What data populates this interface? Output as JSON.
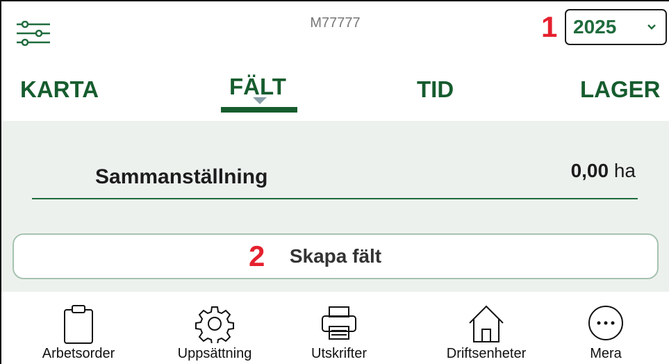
{
  "header": {
    "filter_icon": "filter-sliders-icon",
    "user_id": "M77777",
    "year_select": {
      "value": "2025"
    }
  },
  "annotations": {
    "marker_1": "1",
    "marker_2": "2"
  },
  "tabs": [
    {
      "label": "KARTA",
      "active": false
    },
    {
      "label": "FÄLT",
      "active": true
    },
    {
      "label": "TID",
      "active": false
    },
    {
      "label": "LAGER",
      "active": false
    }
  ],
  "summary": {
    "title": "Sammanställning",
    "area_value": "0,00",
    "area_unit": "ha"
  },
  "create_button": {
    "label": "Skapa fält"
  },
  "bottom_nav": [
    {
      "label": "Arbetsorder",
      "icon": "clipboard-icon"
    },
    {
      "label": "Uppsättning",
      "icon": "gear-icon"
    },
    {
      "label": "Utskrifter",
      "icon": "printer-icon"
    },
    {
      "label": "Driftsenheter",
      "icon": "house-icon"
    },
    {
      "label": "Mera",
      "icon": "more-dots-icon"
    }
  ],
  "colors": {
    "accent": "#165c2e",
    "marker": "#e5202e",
    "content_bg": "#edf1ee"
  }
}
